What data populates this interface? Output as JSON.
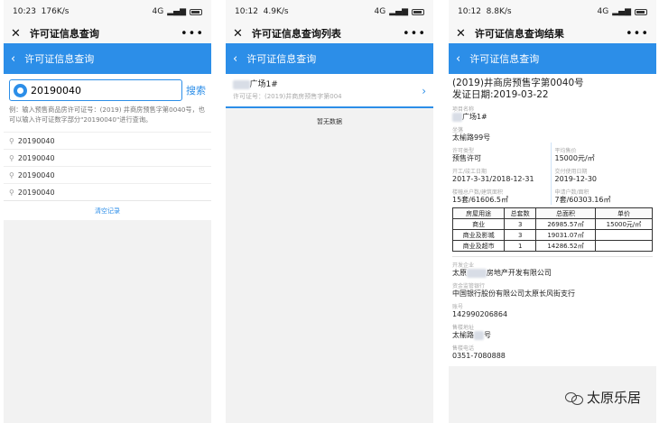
{
  "p1": {
    "status": {
      "time": "10:23",
      "speed": "176K/s",
      "net": "4G",
      "batt": ""
    },
    "wx_title": "许可证信息查询",
    "app_title": "许可证信息查询",
    "search": {
      "value": "20190040",
      "button": "搜索"
    },
    "hint": "例：输入预售商品房许可证号：(2019) 井商房预售字第0040号，也可以输入许可证数字部分\"20190040\"进行查询。",
    "history": [
      "20190040",
      "20190040",
      "20190040",
      "20190040"
    ],
    "clear": "清空记录"
  },
  "p2": {
    "status": {
      "time": "10:12",
      "speed": "4.9K/s",
      "net": "4G"
    },
    "wx_title": "许可证信息查询列表",
    "app_title": "许可证信息查询",
    "item_title": "广场1#",
    "item_sub_label": "许可证号：",
    "item_sub": "(2019)井商房预售字第004",
    "nodata": "暂无数据"
  },
  "p3": {
    "status": {
      "time": "10:12",
      "speed": "8.8K/s",
      "net": "4G"
    },
    "wx_title": "许可证信息查询结果",
    "app_title": "许可证信息查询",
    "license_no": "(2019)井商房预售字第0040号",
    "issue_date": "发证日期:2019-03-22",
    "project_name_label": "项目名称",
    "project_name": "广场1#",
    "location_label": "坐落",
    "location": "太榆路99号",
    "type_label": "许可类型",
    "type": "预售许可",
    "price_label": "平均售价",
    "price": "15000元/㎡",
    "start_end_label": "开工/竣工日期",
    "start_end": "2017-3-31/2018-12-31",
    "delivery_label": "交付使用日期",
    "delivery": "2019-12-30",
    "total_label": "楼幢总户数/建筑面积",
    "total": "15套/61606.5㎡",
    "apply_label": "申请户数/面积",
    "apply": "7套/60303.16㎡",
    "table_headers": [
      "房屋用途",
      "总套数",
      "总面积",
      "单价"
    ],
    "table_rows": [
      [
        "商业",
        "3",
        "26985.57㎡",
        "15000元/㎡"
      ],
      [
        "商业及影城",
        "3",
        "19031.07㎡",
        ""
      ],
      [
        "商业及超市",
        "1",
        "14286.52㎡",
        ""
      ]
    ],
    "dev_label": "开发企业",
    "dev_prefix": "太原",
    "dev_suffix": "房地产开发有限公司",
    "bank_label": "资金监管银行",
    "bank": "中国银行股份有限公司太原长风街支行",
    "account_label": "账号",
    "account": "142990206864",
    "sales_addr_label": "售楼地址",
    "sales_addr_prefix": "太榆路",
    "sales_addr_suffix": "号",
    "phone_label": "售楼电话",
    "phone": "0351-7080888"
  },
  "watermark": "太原乐居"
}
